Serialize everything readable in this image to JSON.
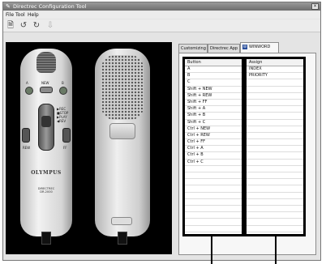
{
  "window": {
    "title": "Directrec Configuration Tool",
    "close_glyph": "×"
  },
  "menu": [
    "File",
    "Tool",
    "Help"
  ],
  "toolbar": {
    "icons": [
      "new-document-icon",
      "open-icon",
      "save-icon",
      "download-icon"
    ]
  },
  "device": {
    "front_buttons": {
      "a": "A",
      "new": "NEW",
      "b": "B",
      "rew": "REW",
      "ff": "FF"
    },
    "slider_labels": [
      "▶REC",
      "■STOP",
      "▶PLAY",
      "◀REV"
    ],
    "brand": "OLYMPUS",
    "model_line1": "DIRECTREC",
    "model_line2": "DR-2000"
  },
  "tabs": [
    {
      "label": "Customizing",
      "active": false
    },
    {
      "label": "Directrec App",
      "active": false
    },
    {
      "label": "WINWORD",
      "active": true
    }
  ],
  "assignment_table": {
    "button_header": "Button",
    "assign_header": "Assign",
    "buttons": [
      "A",
      "B",
      "C",
      "Shift + NEW",
      "Shift + REW",
      "Shift + FF",
      "Shift + A",
      "Shift + B",
      "Shift + C",
      "Ctrl + NEW",
      "Ctrl + REW",
      "Ctrl + FF",
      "Ctrl + A",
      "Ctrl + B",
      "Ctrl + C"
    ],
    "assignments": [
      "INDEX",
      "PRIORITY",
      "",
      "",
      "",
      "",
      "",
      "",
      "",
      "",
      "",
      "",
      "",
      "",
      ""
    ]
  }
}
